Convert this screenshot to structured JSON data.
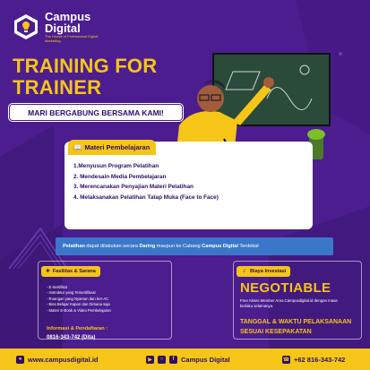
{
  "brand": {
    "name_line1": "Campus",
    "name_line2": "Digital",
    "tagline": "The House of Professional Digital Marketing"
  },
  "title": {
    "line1": "TRAINING FOR",
    "line2": "TRAINER"
  },
  "banner": "MARI BERGABUNG BERSAMA KAMI!",
  "materi": {
    "heading": "Materi Pembelajaran",
    "items": [
      "1.Menyusun Program Pelatihan",
      "2. Mendesain Media Pembelajaran",
      "3. Merencanakan Penyajian Materi Pelatihan",
      "4. Melaksanakan Pelatihan Tatap Muka (Face to Face)"
    ]
  },
  "info_strip": {
    "part1": "Pelatihan",
    "part2": " dapat dilakukan secara ",
    "part3": "Daring",
    "part4": " maupun ke Cabang ",
    "part5": "Campus Digital",
    "part6": " Terdekat"
  },
  "fasilitas": {
    "heading": "Fasilitas & Sarana",
    "items": [
      "- E-Sertifikat",
      "- Instruktur yang Tersertifikasi",
      "- Ruangan yang Nyaman dan ber-AC",
      "- Bisa Belajar Kapan dan Dimana saja",
      "- Materi E-Book & Video Pembelajaran"
    ],
    "contact_label": "Informasi & Pendaftaran :",
    "contact_phone": "0816-343-742 (Dita)"
  },
  "biaya": {
    "heading": "Biaya Investasi",
    "value": "NEGOTIABLE",
    "note": "Free Akses Member Area Campusdigital.id dengan masa berlaku selamanya.",
    "tanggal_line1": "TANGGAL & WAKTU PELAKSANAAN",
    "tanggal_line2": "SESUAI KESEPAKATAN"
  },
  "footer": {
    "website": "www.campusdigital.id",
    "social": "Campus Digital",
    "phone": "+62 816-343-742"
  },
  "colors": {
    "background": "#4b1d8f",
    "accent": "#f5c518",
    "strip": "#3b77c9",
    "text_dark": "#2e0e68"
  }
}
